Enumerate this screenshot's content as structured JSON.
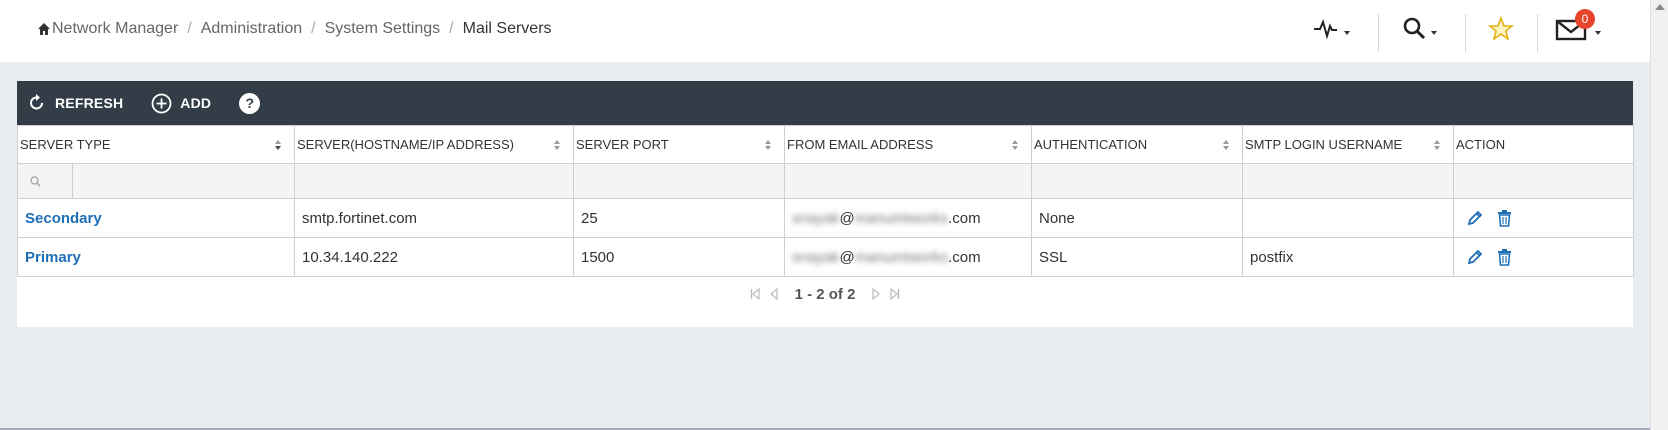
{
  "breadcrumb": {
    "items": [
      "Network Manager",
      "Administration",
      "System Settings",
      "Mail Servers"
    ]
  },
  "header": {
    "icons": [
      "activity-icon",
      "search-icon",
      "star-icon",
      "mail-icon"
    ],
    "notification_count": "0",
    "accent_colors": {
      "star": "#f0c419",
      "badge": "#e8442c"
    }
  },
  "toolbar": {
    "refresh_label": "REFRESH",
    "add_label": "ADD",
    "help_label": "?"
  },
  "table": {
    "columns": [
      "SERVER TYPE",
      "SERVER(HOSTNAME/IP ADDRESS)",
      "SERVER PORT",
      "FROM EMAIL ADDRESS",
      "AUTHENTICATION",
      "SMTP LOGIN USERNAME",
      "ACTION"
    ],
    "rows": [
      {
        "server_type": "Secondary",
        "server": "smtp.fortinet.com",
        "port": "25",
        "email_user": "snayak",
        "email_at": "@",
        "email_domain": "manumtworks",
        "email_tld": ".com",
        "authentication": "None",
        "smtp_username": ""
      },
      {
        "server_type": "Primary",
        "server": "10.34.140.222",
        "port": "1500",
        "email_user": "snayak",
        "email_at": "@",
        "email_domain": "manumtworks",
        "email_tld": ".com",
        "authentication": "SSL",
        "smtp_username": "postfix"
      }
    ]
  },
  "pagination": {
    "range_text": "1 - 2 of 2"
  },
  "colors": {
    "toolbar_bg": "#333d47",
    "link": "#1f6fb8",
    "page_bg": "#e7edf0"
  }
}
